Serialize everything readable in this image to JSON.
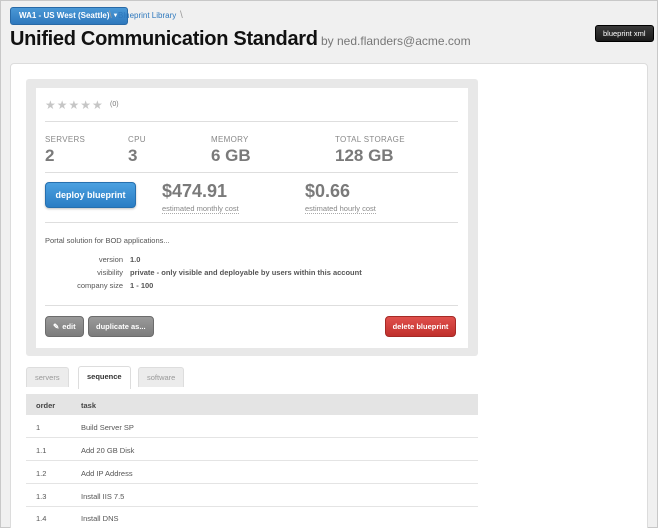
{
  "breadcrumb": {
    "region": "WA1 - US West (Seattle)",
    "separator": "\\",
    "blueprint_library": "Blueprint Library"
  },
  "header": {
    "title": "Unified Communication Standard",
    "owner": "by ned.flanders@acme.com",
    "blueprint_xml": "blueprint xml"
  },
  "rating": {
    "stars": "★★★★★",
    "count": "(0)",
    "value": 0
  },
  "stats": {
    "servers": {
      "label": "SERVERS",
      "value": "2"
    },
    "cpu": {
      "label": "CPU",
      "value": "3"
    },
    "memory": {
      "label": "MEMORY",
      "value": "6 GB"
    },
    "storage": {
      "label": "TOTAL STORAGE",
      "value": "128 GB"
    }
  },
  "deploy_label": "deploy blueprint",
  "costs": {
    "monthly": {
      "value": "$474.91",
      "label": "estimated monthly cost"
    },
    "hourly": {
      "value": "$0.66",
      "label": "estimated hourly cost"
    }
  },
  "description": "Portal solution for BOD applications...",
  "meta": {
    "version": {
      "label": "version",
      "value": "1.0"
    },
    "visibility": {
      "label": "visibility",
      "value": "private - only visible and deployable by users within this account"
    },
    "company_size": {
      "label": "company size",
      "value": "1 - 100"
    }
  },
  "actions": {
    "edit": "edit",
    "duplicate": "duplicate as...",
    "delete": "delete blueprint"
  },
  "tabs": [
    {
      "label": "servers",
      "active": false
    },
    {
      "label": "sequence",
      "active": true
    },
    {
      "label": "software",
      "active": false
    }
  ],
  "table": {
    "columns": [
      "order",
      "task"
    ],
    "rows": [
      [
        "1",
        "Build Server SP"
      ],
      [
        "1.1",
        "Add 20 GB Disk"
      ],
      [
        "1.2",
        "Add IP Address"
      ],
      [
        "1.3",
        "Install IIS 7.5"
      ],
      [
        "1.4",
        "Install DNS"
      ]
    ]
  },
  "colors": {
    "primary_blue": "#2e78bd",
    "delete_red": "#c0302c",
    "neutral_gray": "#7c7c7c"
  },
  "icons": {
    "region_dropdown": "caret-down-icon",
    "edit": "edit-icon",
    "rating": "star-icon"
  }
}
